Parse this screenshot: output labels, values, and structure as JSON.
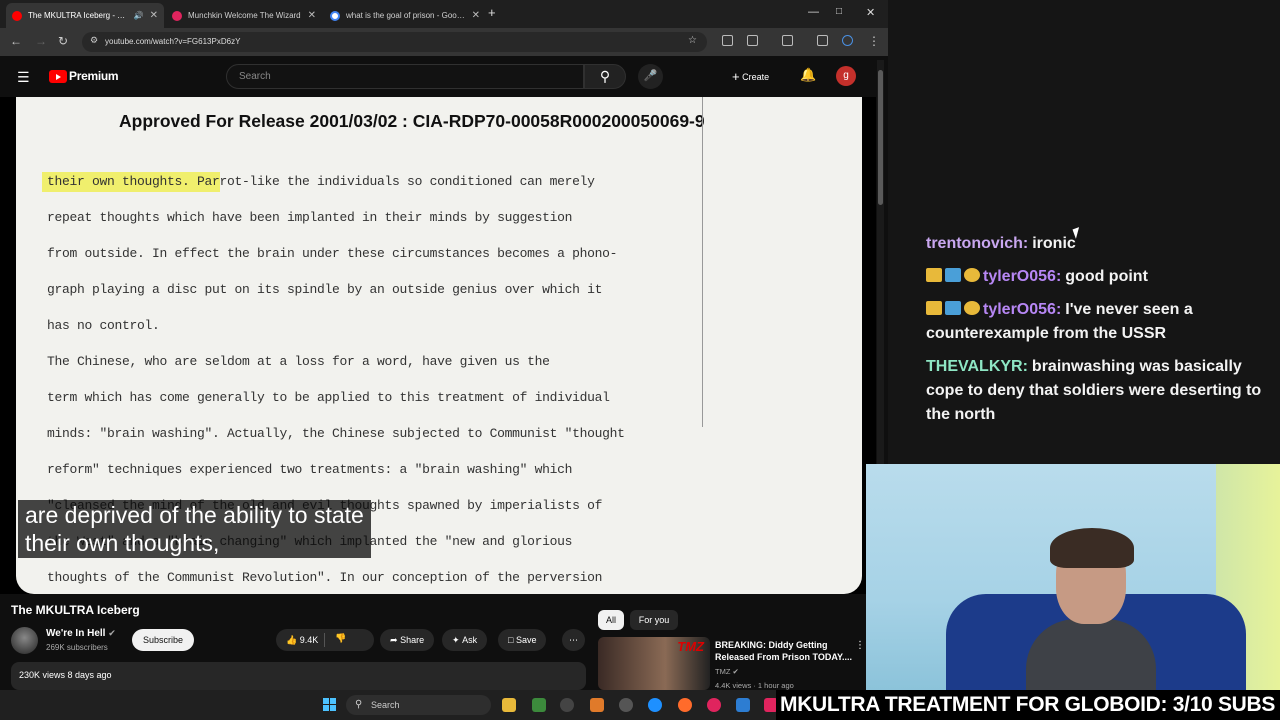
{
  "browser": {
    "tabs": [
      {
        "label": "The MKULTRA Iceberg - YouTube",
        "active": true
      },
      {
        "label": "Munchkin Welcome The Wizard",
        "active": false
      },
      {
        "label": "what is the goal of prison - Google Search",
        "active": false
      }
    ],
    "url": "youtube.com/watch?v=FG613PxD6zY"
  },
  "youtube": {
    "brand": "Premium",
    "search_placeholder": "Search",
    "create_label": "Create",
    "avatar_letter": "g"
  },
  "video": {
    "doc_header": "Approved For Release 2001/03/02 : CIA-RDP70-00058R000200050069-9",
    "doc_lines": [
      "their own thoughts.  Parrot-like the individuals so conditioned can merely",
      "repeat thoughts which have been implanted in their minds by suggestion",
      "from outside.  In effect the brain under these circumstances becomes a phono-",
      "graph playing a disc put on its spindle by an outside genius over which it",
      "has no control.",
      "     The Chinese, who are seldom at a loss for a word, have given us the",
      "term which has come generally to be applied to this treatment of individual",
      "minds:  \"brain washing\".  Actually, the Chinese subjected to Communist \"thought",
      "reform\" techniques experienced two treatments:  a \"brain washing\" which",
      "\"cleansed the mind of the old and evil thoughts spawned by imperialists of",
      "the West\" and a \"brain changing\" which implanted the \"new and glorious",
      "thoughts of the Communist Revolution\".  In our conception of the perversion"
    ],
    "caption_line1": "are deprived of the ability to state",
    "caption_line2": "their own thoughts,",
    "title": "The MKULTRA Iceberg",
    "channel": "We're In Hell",
    "subscribers": "269K subscribers",
    "subscribe_label": "Subscribe",
    "likes": "9.4K",
    "share_label": "Share",
    "ask_label": "Ask",
    "save_label": "Save",
    "views": "230K views  8 days ago"
  },
  "sidebar": {
    "chips": [
      "All",
      "For you"
    ],
    "rec": {
      "title": "BREAKING: Diddy Getting Released From Prison TODAY....",
      "channel": "TMZ",
      "meta": "4.4K views · 1 hour ago",
      "thumb_text": "TMZ"
    }
  },
  "chat": [
    {
      "user": "trentonovich:",
      "text": "ironic",
      "color": "#c9a7f0",
      "badges": 0
    },
    {
      "user": "tylerO056:",
      "text": "good point",
      "color": "#b787f5",
      "badges": 3
    },
    {
      "user": "tylerO056:",
      "text": "I've never seen a counterexample from the USSR",
      "color": "#b787f5",
      "badges": 3
    },
    {
      "user": "THEVALKYR:",
      "text": "brainwashing was basically cope to deny that soldiers were deserting to the north",
      "color": "#8ee6c4",
      "badges": 0
    }
  ],
  "banner": "MKULTRA TREATMENT FOR GLOBOID: 3/10 SUBS",
  "taskbar": {
    "search_label": "Search"
  }
}
